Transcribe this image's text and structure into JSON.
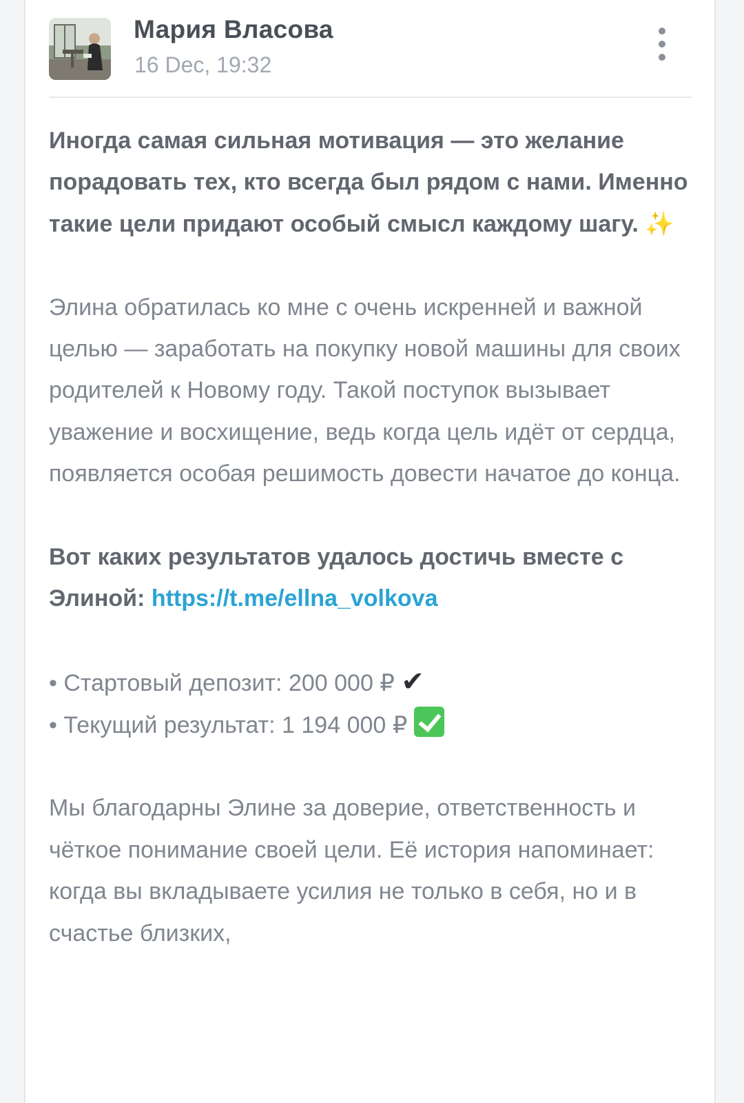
{
  "post": {
    "author": "Мария Власова",
    "date": "16 Dec, 19:32",
    "intro_bold": "Иногда самая сильная мотивация — это желание порадовать тех, кто всегда был рядом с нами. Именно такие цели придают особый смысл каждому шагу.",
    "intro_emoji": "✨",
    "paragraph1": "Элина обратилась ко мне с очень искренней и важной целью — заработать на покупку новой машины для своих родителей к Новому году. Такой поступок вызывает уважение и восхищение, ведь когда цель идёт от сердца, появляется особая решимость довести начатое до конца.",
    "results_bold": "Вот каких результатов удалось достичь вместе с Элиной:",
    "results_link": "https://t.me/ellna_volkova",
    "bullets": [
      {
        "marker": "•",
        "text": "Стартовый депозит: 200 000 ₽",
        "emoji": "✔"
      },
      {
        "marker": "•",
        "text": "Текущий результат: 1 194 000 ₽",
        "emoji": "check-box-icon"
      }
    ],
    "paragraph2": "Мы благодарны Элине за доверие, ответственность и чёткое понимание своей цели. Её история напоминает: когда вы вкладываете усилия не только в себя, но и в счастье близких,"
  }
}
